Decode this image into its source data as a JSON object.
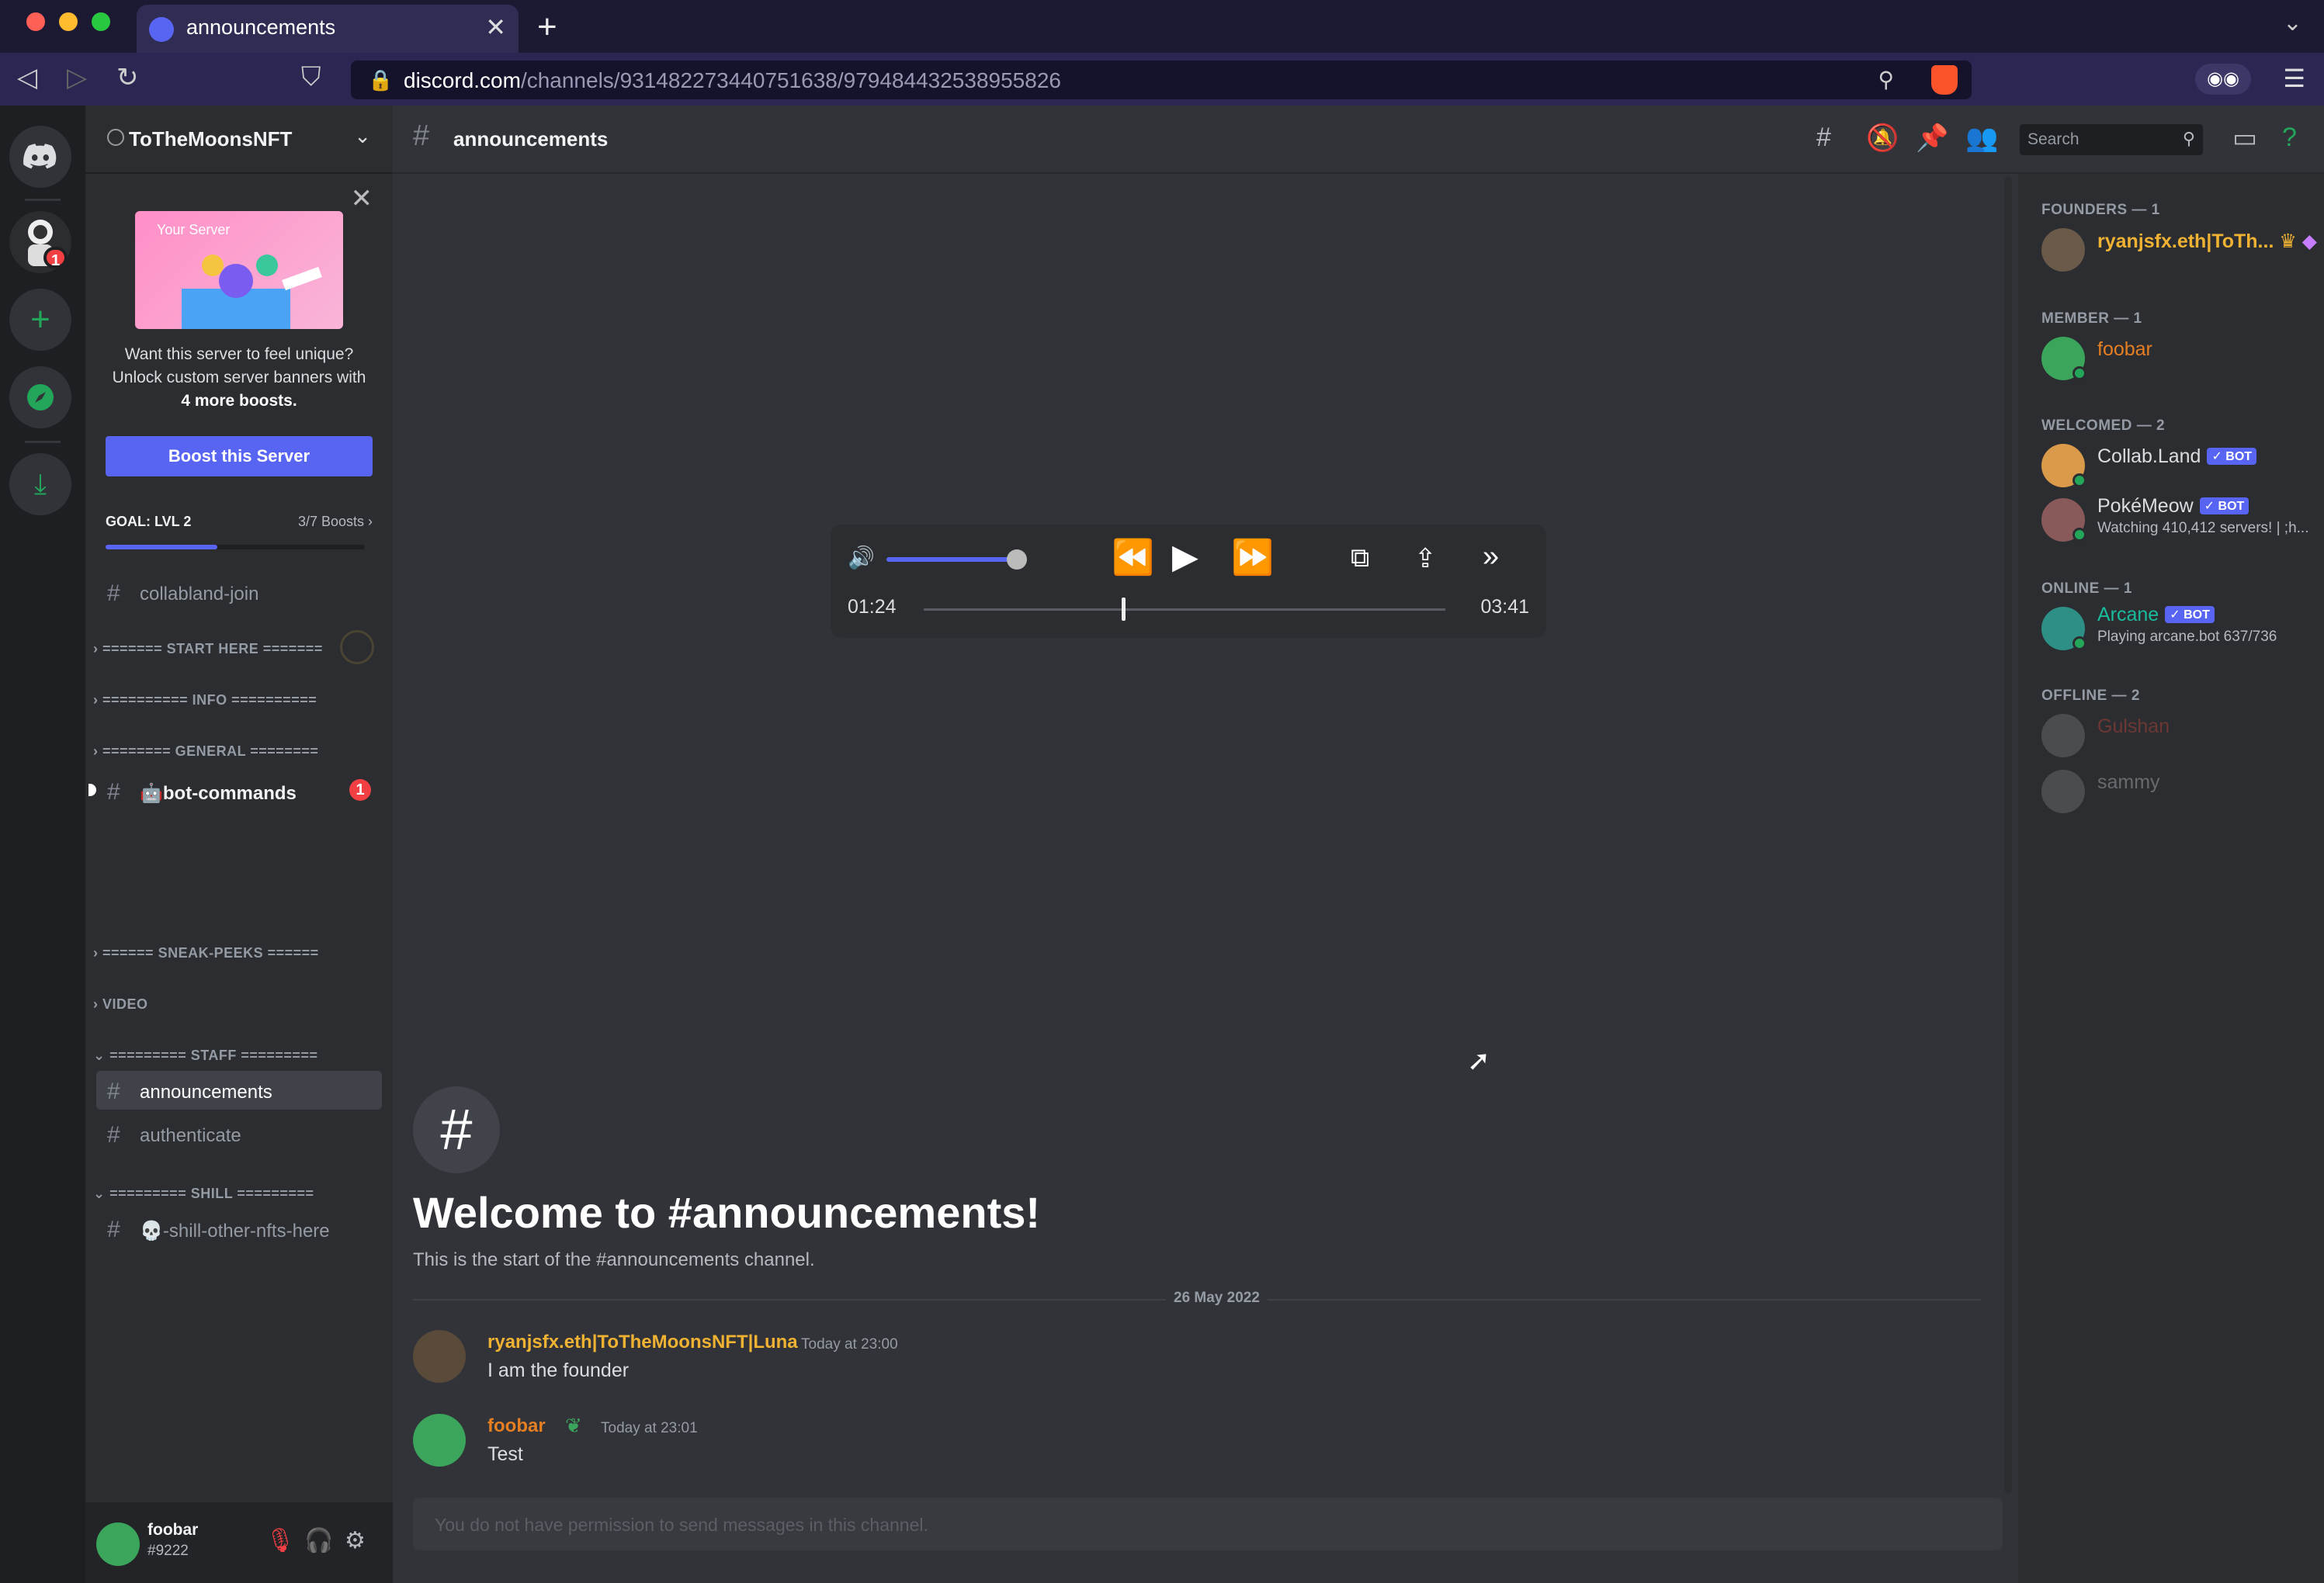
{
  "browser": {
    "tab_title": "announcements",
    "url_host": "discord.com",
    "url_path": "/channels/931482273440751638/979484432538955826"
  },
  "server": {
    "name": "ToTheMoonsNFT",
    "notification_count": "1"
  },
  "boost": {
    "art_label": "Your Server",
    "message_line1": "Want this server to feel unique?",
    "message_line2": "Unlock custom server banners with",
    "message_bold": "4 more boosts.",
    "button": "Boost this Server",
    "goal_label": "GOAL: LVL 2",
    "goal_count": "3/7 Boosts",
    "goal_progress": 0.43
  },
  "channels": {
    "collabland": "collabland-join",
    "cat_start": "======= START HERE =======",
    "cat_info": "========== INFO ==========",
    "cat_general": "======== GENERAL ========",
    "bot_commands": "bot-commands",
    "bot_badge": "1",
    "cat_sneak": "====== SNEAK-PEEKS ======",
    "cat_video": "VIDEO",
    "cat_staff": "========= STAFF =========",
    "announcements": "announcements",
    "authenticate": "authenticate",
    "cat_shill": "========= SHILL =========",
    "shill": "-shill-other-nfts-here"
  },
  "user": {
    "name": "foobar",
    "tag": "#9222"
  },
  "channel": {
    "name": "announcements",
    "search_placeholder": "Search",
    "welcome_title": "Welcome to #announcements!",
    "welcome_sub": "This is the start of the #announcements channel.",
    "date_divider": "26 May 2022",
    "composer_placeholder": "You do not have permission to send messages in this channel."
  },
  "player": {
    "current_time": "01:24",
    "duration": "03:41",
    "progress": 0.38,
    "volume": 0.85
  },
  "messages": [
    {
      "author": "ryanjsfx.eth|ToTheMoonsNFT|Luna",
      "time": "Today at 23:00",
      "text": "I am the founder",
      "color": "#f0b232"
    },
    {
      "author": "foobar",
      "time": "Today at 23:01",
      "text": "Test",
      "color": "#e67e22"
    }
  ],
  "members": {
    "founders": "FOUNDERS — 1",
    "founder_name": "ryanjsfx.eth|ToTh...",
    "member": "MEMBER — 1",
    "member_name": "foobar",
    "welcomed": "WELCOMED — 2",
    "collab": "Collab.Land",
    "pokemeow": "PokéMeow",
    "pokemeow_status": "Watching 410,412 servers! | ;h...",
    "online": "ONLINE — 1",
    "arcane": "Arcane",
    "arcane_status": "Playing arcane.bot 637/736",
    "offline": "OFFLINE — 2",
    "gulshan": "Gulshan",
    "sammy": "sammy",
    "bot_tag": "✓ BOT"
  },
  "colors": {
    "blurple": "#5865f2",
    "founder_gold": "#f0b232",
    "member_orange": "#e67e22",
    "online_green": "#23a55a"
  }
}
